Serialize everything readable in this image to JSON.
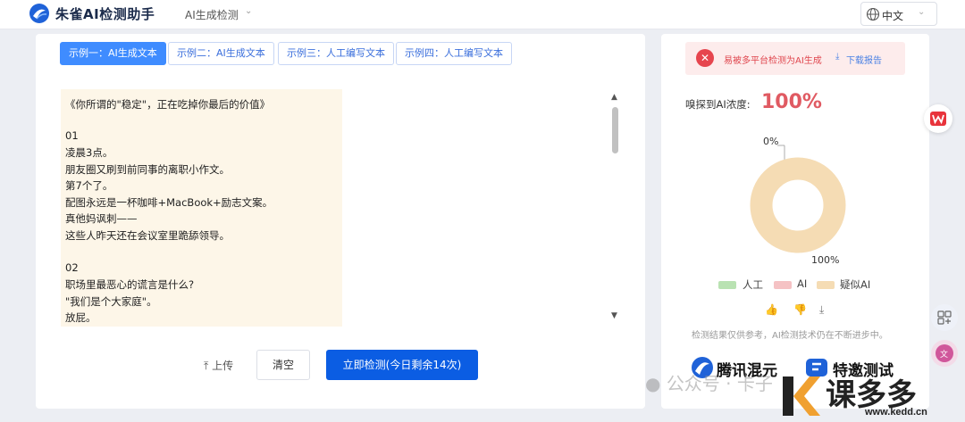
{
  "header": {
    "brand": "朱雀AI检测助手",
    "mode": "AI生成检测",
    "language": "中文"
  },
  "tabs": [
    {
      "label": "示例一：AI生成文本",
      "active": true
    },
    {
      "label": "示例二：AI生成文本",
      "active": false
    },
    {
      "label": "示例三：人工编写文本",
      "active": false
    },
    {
      "label": "示例四：人工编写文本",
      "active": false
    }
  ],
  "editor": {
    "lines": [
      "《你所谓的\"稳定\"，正在吃掉你最后的价值》",
      "",
      "01",
      "凌晨3点。",
      "朋友圈又刷到前同事的离职小作文。",
      "第7个了。",
      "配图永远是一杯咖啡+MacBook+励志文案。",
      "真他妈讽刺——",
      "这些人昨天还在会议室里跪舔领导。",
      "",
      "02",
      "职场里最恶心的谎言是什么?",
      "\"我们是个大家庭\"。",
      "放屁。"
    ]
  },
  "actions": {
    "upload": "上传",
    "clear": "清空",
    "detect": "立即检测(今日剩余14次)"
  },
  "result": {
    "alert": "易被多平台检测为AI生成",
    "download": "下载报告",
    "concentration_label": "嗅探到AI浓度:",
    "concentration_value": "100%",
    "pct_top": "0%",
    "pct_bottom": "100%",
    "legend": [
      {
        "label": "人工",
        "color": "#b9e2b2"
      },
      {
        "label": "AI",
        "color": "#f5c2c4"
      },
      {
        "label": "疑似AI",
        "color": "#f5dcb4"
      }
    ],
    "disclaimer": "检测结果仅供参考，AI检测技术仍在不断进步中。",
    "partners": [
      "腾讯混元",
      "特邀测试"
    ]
  },
  "chart_data": {
    "type": "pie",
    "categories": [
      "人工",
      "AI",
      "疑似AI"
    ],
    "values": [
      0,
      0,
      100
    ]
  },
  "watermark": {
    "wechat": "公众号 · 卡子",
    "brand": "课多多",
    "url": "www.kedd.cn"
  },
  "colors": {
    "primary": "#0b5de3",
    "tab_active": "#3f8cff",
    "danger": "#e05a62",
    "donut": "#f5dcb4"
  }
}
